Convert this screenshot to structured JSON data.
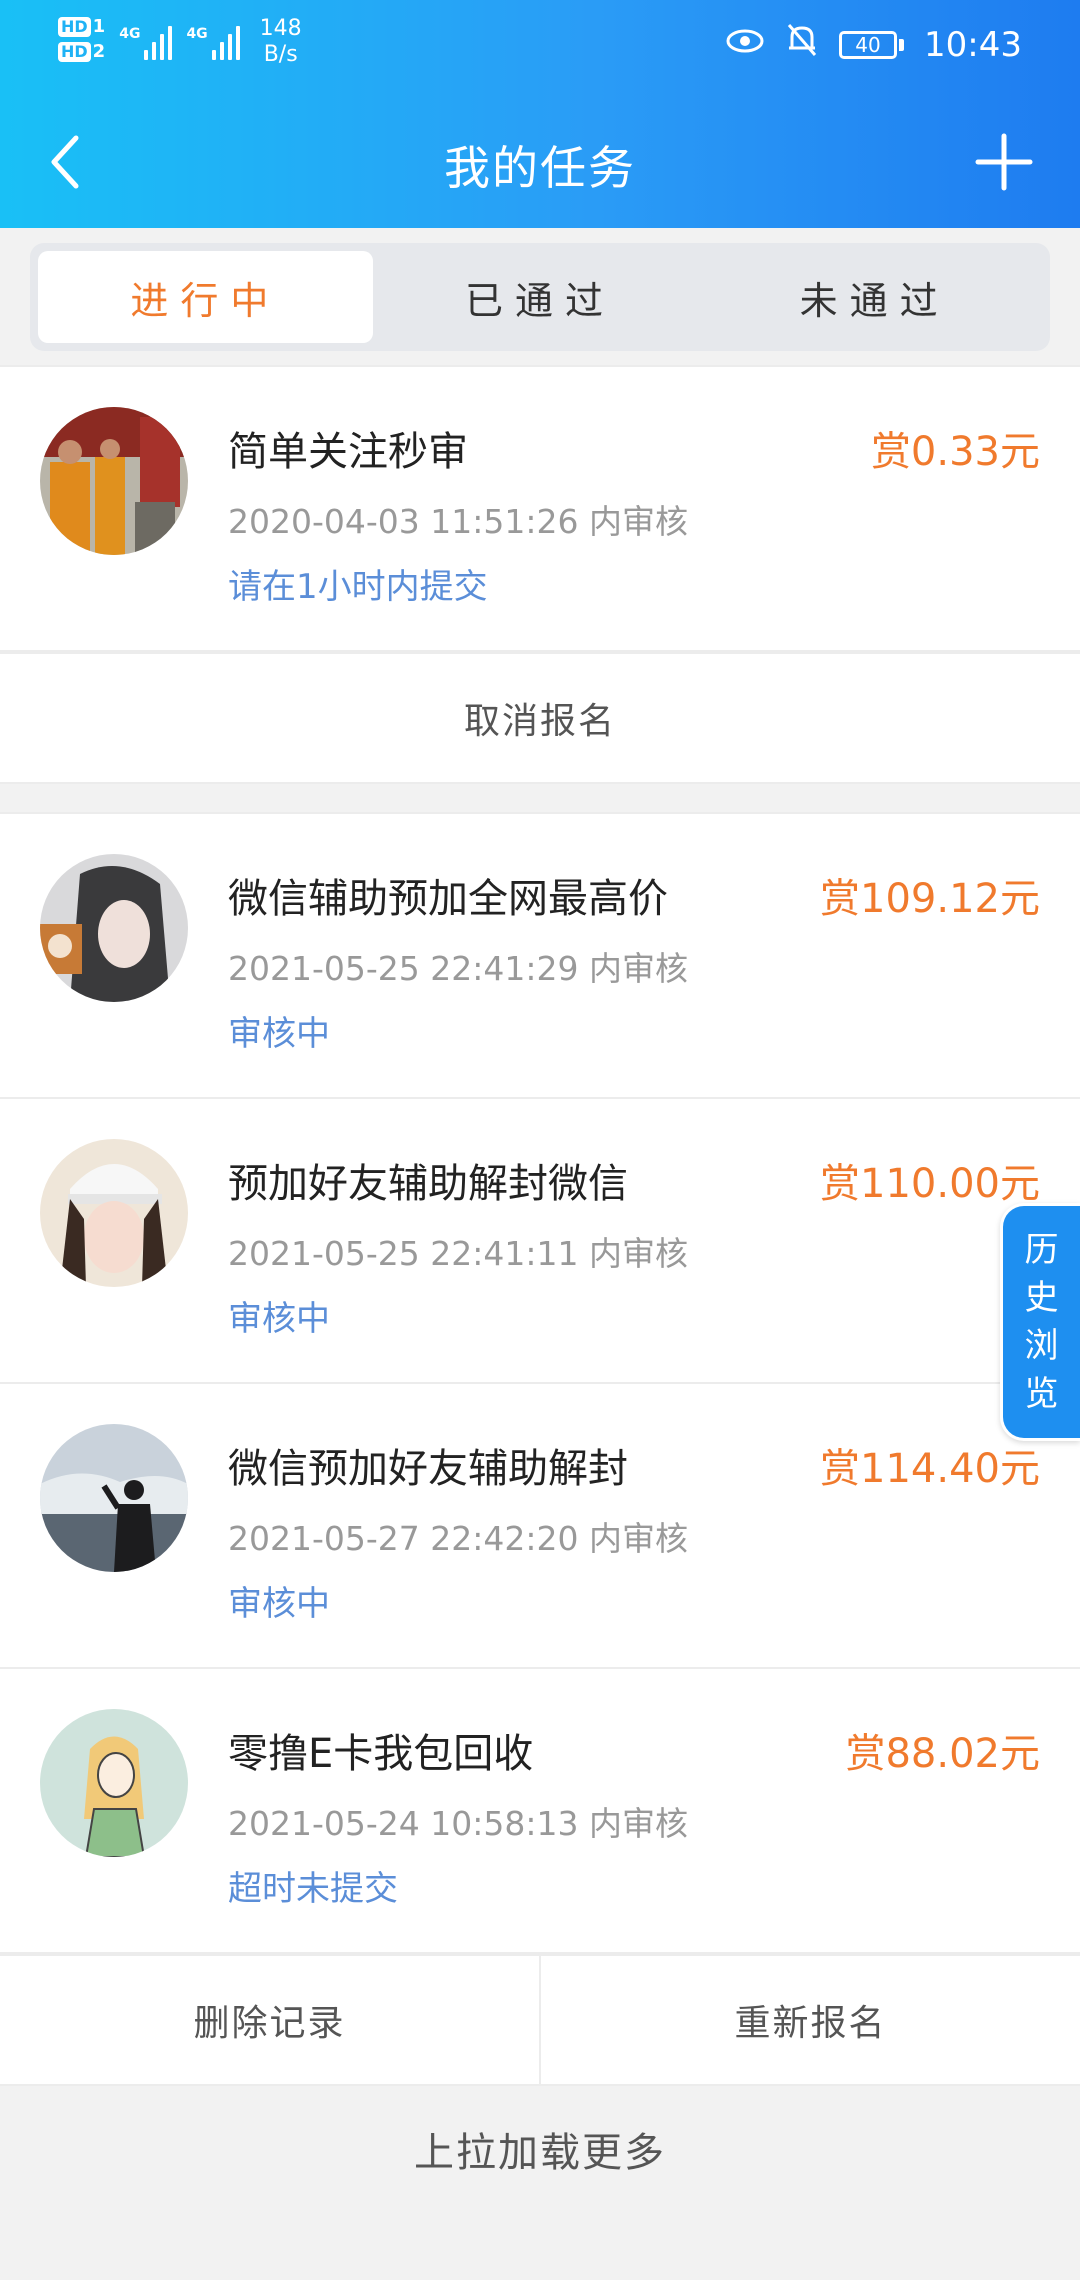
{
  "status_bar": {
    "hd1": "HD",
    "hd1_sub": "1",
    "hd2": "HD",
    "hd2_sub": "2",
    "net1": "4G",
    "net2": "4G",
    "speed_value": "148",
    "speed_unit": "B/s",
    "battery": "40",
    "time": "10:43"
  },
  "nav": {
    "title": "我的任务"
  },
  "tabs": [
    {
      "label": "进行中",
      "active": true
    },
    {
      "label": "已通过",
      "active": false
    },
    {
      "label": "未通过",
      "active": false
    }
  ],
  "tasks": [
    {
      "title": "简单关注秒审",
      "reward": "赏0.33元",
      "time": "2020-04-03 11:51:26 内审核",
      "status": "请在1小时内提交"
    },
    {
      "title": "微信辅助预加全网最高价",
      "reward": "赏109.12元",
      "time": "2021-05-25 22:41:29 内审核",
      "status": "审核中"
    },
    {
      "title": "预加好友辅助解封微信",
      "reward": "赏110.00元",
      "time": "2021-05-25 22:41:11 内审核",
      "status": "审核中"
    },
    {
      "title": "微信预加好友辅助解封",
      "reward": "赏114.40元",
      "time": "2021-05-27 22:42:20 内审核",
      "status": "审核中"
    },
    {
      "title": "零撸E卡我包回收",
      "reward": "赏88.02元",
      "time": "2021-05-24 10:58:13 内审核",
      "status": "超时未提交"
    }
  ],
  "actions": {
    "cancel_signup": "取消报名",
    "delete_record": "删除记录",
    "resignup": "重新报名"
  },
  "load_more": "上拉加载更多",
  "history_float": [
    "历",
    "史",
    "浏",
    "览"
  ],
  "colors": {
    "accent": "#f07a2d",
    "status_blue": "#5b8ed8",
    "header_start": "#19c0f6",
    "header_end": "#1e7cf0"
  }
}
